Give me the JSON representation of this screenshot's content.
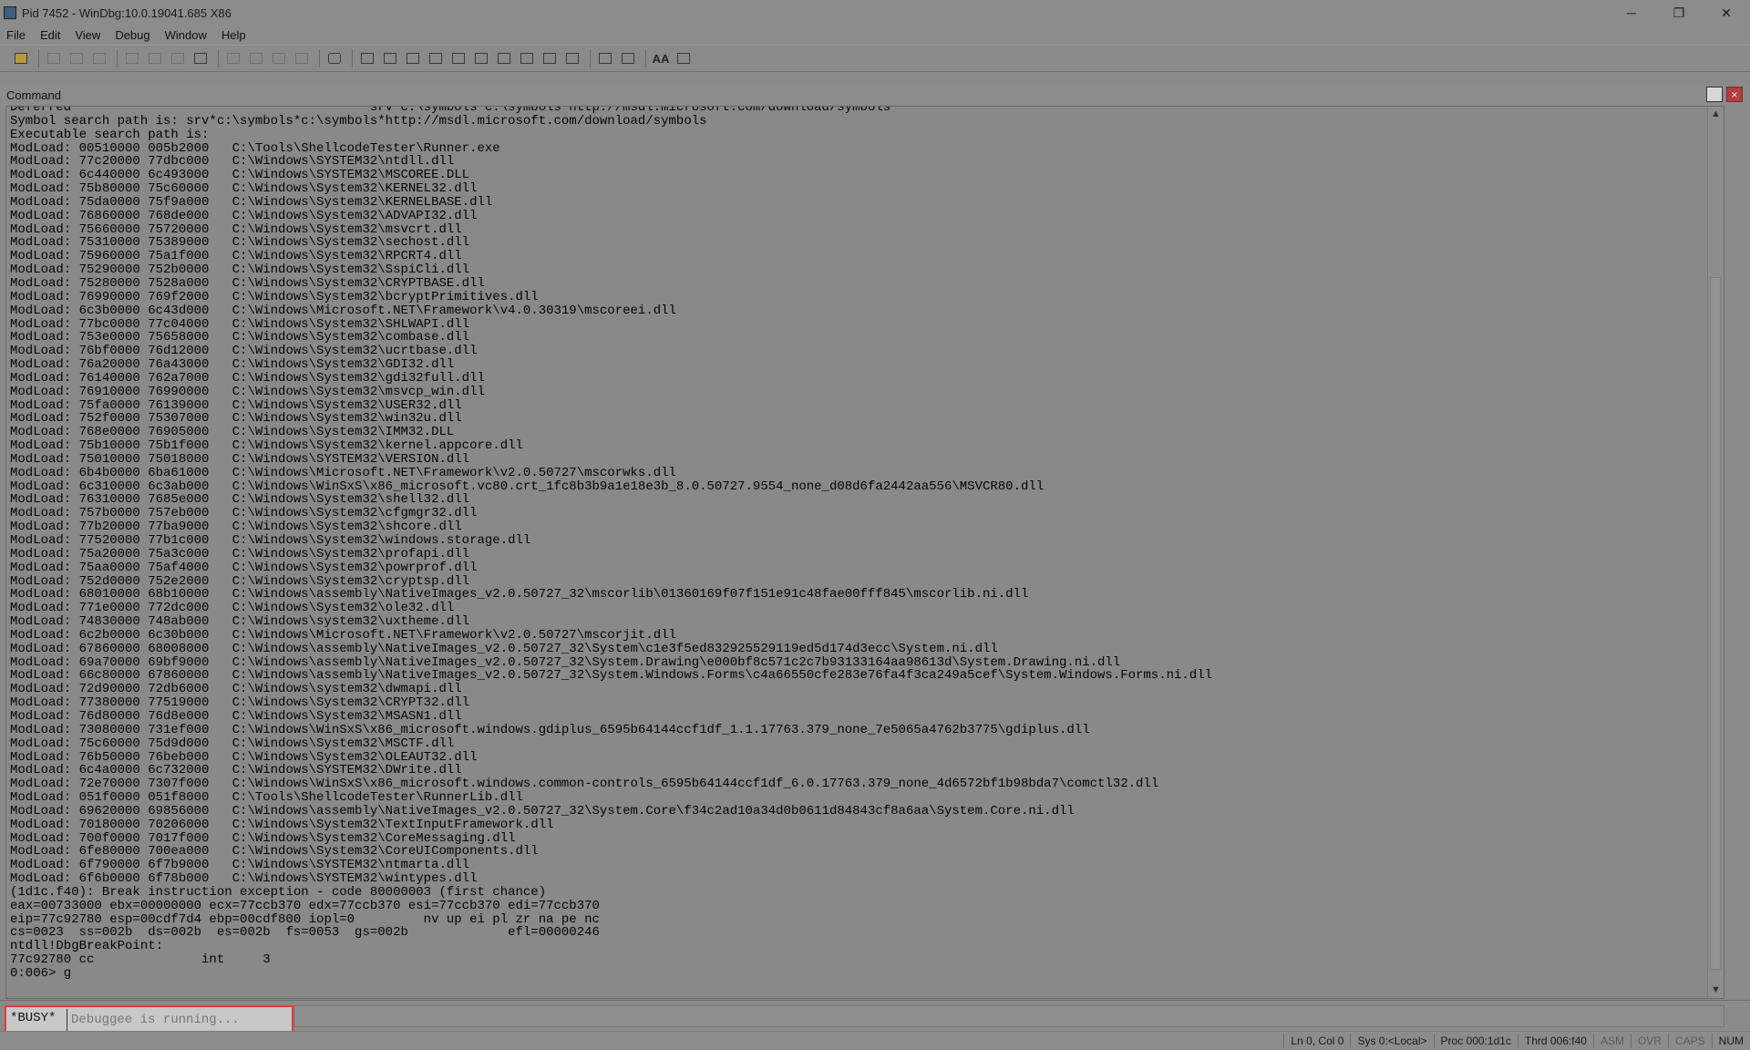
{
  "window": {
    "title": "Pid 7452 - WinDbg:10.0.19041.685 X86",
    "controls": [
      "─",
      "❐",
      "✕"
    ]
  },
  "menu": [
    "File",
    "Edit",
    "View",
    "Debug",
    "Window",
    "Help"
  ],
  "toolbar": {
    "font_button_label": "AA"
  },
  "command_window": {
    "title": "Command",
    "output_lines": [
      "Deferred                                       srv*c:\\symbols*c:\\symbols*http://msdl.microsoft.com/download/symbols",
      "Symbol search path is: srv*c:\\symbols*c:\\symbols*http://msdl.microsoft.com/download/symbols",
      "Executable search path is:",
      "ModLoad: 00510000 005b2000   C:\\Tools\\ShellcodeTester\\Runner.exe",
      "ModLoad: 77c20000 77dbc000   C:\\Windows\\SYSTEM32\\ntdll.dll",
      "ModLoad: 6c440000 6c493000   C:\\Windows\\SYSTEM32\\MSCOREE.DLL",
      "ModLoad: 75b80000 75c60000   C:\\Windows\\System32\\KERNEL32.dll",
      "ModLoad: 75da0000 75f9a000   C:\\Windows\\System32\\KERNELBASE.dll",
      "ModLoad: 76860000 768de000   C:\\Windows\\System32\\ADVAPI32.dll",
      "ModLoad: 75660000 75720000   C:\\Windows\\System32\\msvcrt.dll",
      "ModLoad: 75310000 75389000   C:\\Windows\\System32\\sechost.dll",
      "ModLoad: 75960000 75a1f000   C:\\Windows\\System32\\RPCRT4.dll",
      "ModLoad: 75290000 752b0000   C:\\Windows\\System32\\SspiCli.dll",
      "ModLoad: 75280000 7528a000   C:\\Windows\\System32\\CRYPTBASE.dll",
      "ModLoad: 76990000 769f2000   C:\\Windows\\System32\\bcryptPrimitives.dll",
      "ModLoad: 6c3b0000 6c43d000   C:\\Windows\\Microsoft.NET\\Framework\\v4.0.30319\\mscoreei.dll",
      "ModLoad: 77bc0000 77c04000   C:\\Windows\\System32\\SHLWAPI.dll",
      "ModLoad: 753e0000 75658000   C:\\Windows\\System32\\combase.dll",
      "ModLoad: 76bf0000 76d12000   C:\\Windows\\System32\\ucrtbase.dll",
      "ModLoad: 76a20000 76a43000   C:\\Windows\\System32\\GDI32.dll",
      "ModLoad: 76140000 762a7000   C:\\Windows\\System32\\gdi32full.dll",
      "ModLoad: 76910000 76990000   C:\\Windows\\System32\\msvcp_win.dll",
      "ModLoad: 75fa0000 76139000   C:\\Windows\\System32\\USER32.dll",
      "ModLoad: 752f0000 75307000   C:\\Windows\\System32\\win32u.dll",
      "ModLoad: 768e0000 76905000   C:\\Windows\\System32\\IMM32.DLL",
      "ModLoad: 75b10000 75b1f000   C:\\Windows\\System32\\kernel.appcore.dll",
      "ModLoad: 75010000 75018000   C:\\Windows\\SYSTEM32\\VERSION.dll",
      "ModLoad: 6b4b0000 6ba61000   C:\\Windows\\Microsoft.NET\\Framework\\v2.0.50727\\mscorwks.dll",
      "ModLoad: 6c310000 6c3ab000   C:\\Windows\\WinSxS\\x86_microsoft.vc80.crt_1fc8b3b9a1e18e3b_8.0.50727.9554_none_d08d6fa2442aa556\\MSVCR80.dll",
      "ModLoad: 76310000 7685e000   C:\\Windows\\System32\\shell32.dll",
      "ModLoad: 757b0000 757eb000   C:\\Windows\\System32\\cfgmgr32.dll",
      "ModLoad: 77b20000 77ba9000   C:\\Windows\\System32\\shcore.dll",
      "ModLoad: 77520000 77b1c000   C:\\Windows\\System32\\windows.storage.dll",
      "ModLoad: 75a20000 75a3c000   C:\\Windows\\System32\\profapi.dll",
      "ModLoad: 75aa0000 75af4000   C:\\Windows\\System32\\powrprof.dll",
      "ModLoad: 752d0000 752e2000   C:\\Windows\\System32\\cryptsp.dll",
      "ModLoad: 68010000 68b10000   C:\\Windows\\assembly\\NativeImages_v2.0.50727_32\\mscorlib\\01360169f07f151e91c48fae00fff845\\mscorlib.ni.dll",
      "ModLoad: 771e0000 772dc000   C:\\Windows\\System32\\ole32.dll",
      "ModLoad: 74830000 748ab000   C:\\Windows\\system32\\uxtheme.dll",
      "ModLoad: 6c2b0000 6c30b000   C:\\Windows\\Microsoft.NET\\Framework\\v2.0.50727\\mscorjit.dll",
      "ModLoad: 67860000 68008000   C:\\Windows\\assembly\\NativeImages_v2.0.50727_32\\System\\c1e3f5ed832925529119ed5d174d3ecc\\System.ni.dll",
      "ModLoad: 69a70000 69bf9000   C:\\Windows\\assembly\\NativeImages_v2.0.50727_32\\System.Drawing\\e000bf8c571c2c7b93133164aa98613d\\System.Drawing.ni.dll",
      "ModLoad: 66c80000 67860000   C:\\Windows\\assembly\\NativeImages_v2.0.50727_32\\System.Windows.Forms\\c4a66550cfe283e76fa4f3ca249a5cef\\System.Windows.Forms.ni.dll",
      "ModLoad: 72d90000 72db6000   C:\\Windows\\system32\\dwmapi.dll",
      "ModLoad: 77380000 77519000   C:\\Windows\\System32\\CRYPT32.dll",
      "ModLoad: 76d80000 76d8e000   C:\\Windows\\System32\\MSASN1.dll",
      "ModLoad: 73080000 731ef000   C:\\Windows\\WinSxS\\x86_microsoft.windows.gdiplus_6595b64144ccf1df_1.1.17763.379_none_7e5065a4762b3775\\gdiplus.dll",
      "ModLoad: 75c60000 75d9d000   C:\\Windows\\System32\\MSCTF.dll",
      "ModLoad: 76b50000 76beb000   C:\\Windows\\System32\\OLEAUT32.dll",
      "ModLoad: 6c4a0000 6c732000   C:\\Windows\\SYSTEM32\\DWrite.dll",
      "ModLoad: 72e70000 7307f000   C:\\Windows\\WinSxS\\x86_microsoft.windows.common-controls_6595b64144ccf1df_6.0.17763.379_none_4d6572bf1b98bda7\\comctl32.dll",
      "ModLoad: 051f0000 051f8000   C:\\Tools\\ShellcodeTester\\RunnerLib.dll",
      "ModLoad: 69620000 69856000   C:\\Windows\\assembly\\NativeImages_v2.0.50727_32\\System.Core\\f34c2ad10a34d0b0611d84843cf8a6aa\\System.Core.ni.dll",
      "ModLoad: 70180000 70206000   C:\\Windows\\System32\\TextInputFramework.dll",
      "ModLoad: 700f0000 7017f000   C:\\Windows\\System32\\CoreMessaging.dll",
      "ModLoad: 6fe80000 700ea000   C:\\Windows\\System32\\CoreUIComponents.dll",
      "ModLoad: 6f790000 6f7b9000   C:\\Windows\\SYSTEM32\\ntmarta.dll",
      "ModLoad: 6f6b0000 6f78b000   C:\\Windows\\SYSTEM32\\wintypes.dll",
      "(1d1c.f40): Break instruction exception - code 80000003 (first chance)",
      "eax=00733000 ebx=00000000 ecx=77ccb370 edx=77ccb370 esi=77ccb370 edi=77ccb370",
      "eip=77c92780 esp=00cdf7d4 ebp=00cdf800 iopl=0         nv up ei pl zr na pe nc",
      "cs=0023  ss=002b  ds=002b  es=002b  fs=0053  gs=002b             efl=00000246",
      "ntdll!DbgBreakPoint:",
      "77c92780 cc              int     3",
      "0:006> g"
    ]
  },
  "command_input": {
    "busy_label": "*BUSY*",
    "placeholder": "Debuggee is running..."
  },
  "statusbar": {
    "cells": [
      {
        "text": "Ln 0, Col 0",
        "dim": false
      },
      {
        "text": "Sys 0:<Local>",
        "dim": false
      },
      {
        "text": "Proc 000:1d1c",
        "dim": false
      },
      {
        "text": "Thrd 006:f40",
        "dim": false
      },
      {
        "text": "ASM",
        "dim": true
      },
      {
        "text": "OVR",
        "dim": true
      },
      {
        "text": "CAPS",
        "dim": true
      },
      {
        "text": "NUM",
        "dim": false
      }
    ]
  },
  "colors": {
    "highlight_border": "#e23b3b",
    "close_button": "#b43d3d"
  }
}
